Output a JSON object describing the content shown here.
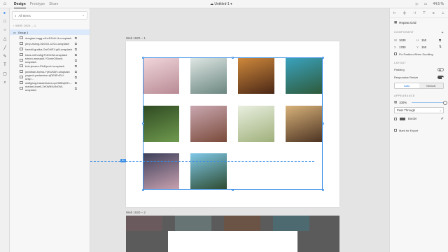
{
  "topbar": {
    "tabs": [
      "Design",
      "Prototype",
      "Share"
    ],
    "active_tab": "Design",
    "document_title": "Untitled-1",
    "zoom": "44.5 %"
  },
  "layers": {
    "search_label": "All Items",
    "breadcrumb": "WEB 1920 – 1",
    "group_name": "Group 1",
    "items": [
      "douglas-bagg-eKvr5J1dLLk-unsplash",
      "jerry-zhang-3UGXJ-UJCo-unsplash",
      "harshil-gudka-OwO4tSY-gM-unsplash",
      "hans-veth-MqjrTl4CbSA-unsplash",
      "simon-marsault-Y3omrO8owd-unsplash",
      "bob-jensen-Ptr4fpzvU-unsplash",
      "jonathan-borba-YyKUK8H-unsplash",
      "yogesh-pedamkar-xjDE8FdGU-unsp...",
      "wolfgang-hasselmann-qoHMDqWH-...",
      "marian-kroell-ZrKWNKz3vDW-unsplash"
    ]
  },
  "canvas": {
    "artboard1_label": "Web 1920 – 1",
    "artboard2_label": "Web 1920 – 2",
    "guide_tag": "61",
    "photo_colors": [
      {
        "a": "#f1d7dc",
        "b": "#b88a94"
      },
      {
        "a": "#dfe7e4",
        "b": "#6b8680"
      },
      {
        "a": "#d08a3c",
        "b": "#4a2716"
      },
      {
        "a": "#3aa3c0",
        "b": "#2e5a3a"
      },
      {
        "a": "#2f4a22",
        "b": "#6f9a4e"
      },
      {
        "a": "#c9a7b0",
        "b": "#7a4a3a"
      },
      {
        "a": "#e9efe0",
        "b": "#9fb07a"
      },
      {
        "a": "#d8b27a",
        "b": "#4c3322"
      },
      {
        "a": "#3c3f5a",
        "b": "#caa2b0"
      },
      {
        "a": "#7fc8e8",
        "b": "#2d4a2e"
      }
    ]
  },
  "properties": {
    "repeat_grid": "Repeat Grid",
    "component_section": "COMPONENT",
    "w_label": "W",
    "w_value": "1630",
    "h_label": "H",
    "h_value": "150",
    "x_label": "X",
    "x_value": "1780",
    "y_label": "Y",
    "y_value": "150",
    "fix_position": "Fix Position When Scrolling",
    "layout_section": "LAYOUT",
    "padding_label": "Padding",
    "responsive_label": "Responsive Resize",
    "seg_auto": "Auto",
    "seg_manual": "Manual",
    "appearance_section": "APPEARANCE",
    "opacity_value": "100%",
    "blend_mode": "Pass Through",
    "border_label": "Border",
    "mark_export": "Mark for Export",
    "accent": "#1473e6"
  }
}
